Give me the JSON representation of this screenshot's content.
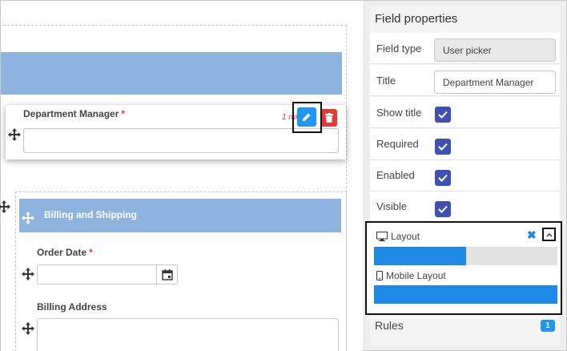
{
  "form": {
    "dragged_field": {
      "label": "Department Manager",
      "required_mark": "*",
      "rule_text": "1 rule"
    },
    "section": {
      "title": "Billing and Shipping",
      "order_date": {
        "label": "Order Date",
        "required_mark": "*"
      },
      "billing_address": {
        "label": "Billing Address"
      }
    }
  },
  "panel": {
    "title": "Field properties",
    "rows": [
      {
        "label": "Field type",
        "value": "User picker"
      },
      {
        "label": "Title",
        "value": "Department Manager"
      },
      {
        "label": "Show title",
        "checked": true
      },
      {
        "label": "Required",
        "checked": true
      },
      {
        "label": "Enabled",
        "checked": true
      },
      {
        "label": "Visible",
        "checked": true
      }
    ],
    "layout": {
      "label": "Layout",
      "fill_percent": 50
    },
    "mobile_layout": {
      "label": "Mobile Layout",
      "fill_percent": 100
    },
    "rules": {
      "label": "Rules",
      "count": "1"
    }
  },
  "colors": {
    "accent_blue": "#2196f3",
    "section_blue": "#8db3de",
    "checkbox": "#3f51b5",
    "danger": "#e53935"
  }
}
